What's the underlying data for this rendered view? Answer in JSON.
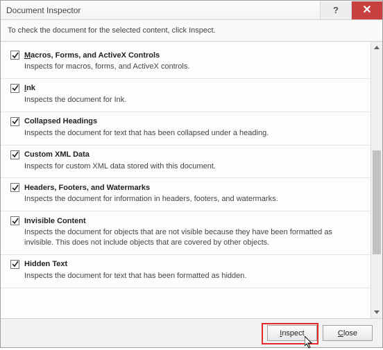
{
  "titlebar": {
    "title": "Document Inspector",
    "help_glyph": "?",
    "close_glyph": "✕"
  },
  "instruction": "To check the document for the selected content, click Inspect.",
  "items": [
    {
      "checked": true,
      "accel": "M",
      "rest": "acros, Forms, and ActiveX Controls",
      "desc": "Inspects for macros, forms, and ActiveX controls."
    },
    {
      "checked": true,
      "accel": "I",
      "rest": "nk",
      "desc": "Inspects the document for Ink."
    },
    {
      "checked": true,
      "title_plain": "Collapsed Headings",
      "desc": "Inspects the document for text that has been collapsed under a heading."
    },
    {
      "checked": true,
      "title_plain": "Custom XML Data",
      "desc": "Inspects for custom XML data stored with this document."
    },
    {
      "checked": true,
      "title_plain": "Headers, Footers, and Watermarks",
      "desc": "Inspects the document for information in headers, footers, and watermarks."
    },
    {
      "checked": true,
      "title_plain": "Invisible Content",
      "desc": "Inspects the document for objects that are not visible because they have been formatted as invisible. This does not include objects that are covered by other objects."
    },
    {
      "checked": true,
      "title_plain": "Hidden Text",
      "desc": "Inspects the document for text that has been formatted as hidden."
    }
  ],
  "buttons": {
    "inspect_accel": "I",
    "inspect_rest": "nspect",
    "close_accel": "C",
    "close_rest": "lose"
  }
}
